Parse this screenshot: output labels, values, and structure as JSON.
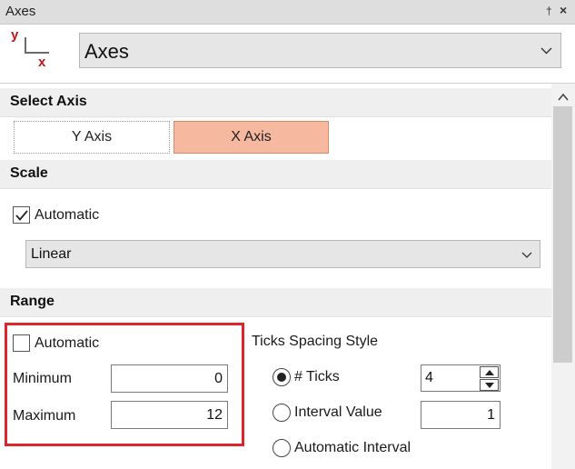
{
  "window": {
    "title": "Axes",
    "pin_glyph": "†",
    "close_glyph": "×"
  },
  "top": {
    "logo": {
      "y_letter": "y",
      "x_letter": "x",
      "icon": "axes-logo-icon"
    },
    "selector_value": "Axes"
  },
  "select_axis": {
    "header": "Select Axis",
    "tabs": [
      {
        "label": "Y Axis",
        "selected": false
      },
      {
        "label": "X Axis",
        "selected": true
      }
    ]
  },
  "scale": {
    "header": "Scale",
    "automatic_label": "Automatic",
    "automatic_checked": true,
    "type_value": "Linear"
  },
  "range": {
    "header": "Range",
    "automatic_label": "Automatic",
    "automatic_checked": false,
    "minimum_label": "Minimum",
    "minimum_value": "0",
    "maximum_label": "Maximum",
    "maximum_value": "12",
    "highlight_color": "#e0242b"
  },
  "ticks": {
    "title": "Ticks Spacing Style",
    "options": [
      {
        "label": "# Ticks",
        "selected": true
      },
      {
        "label": "Interval Value",
        "selected": false
      },
      {
        "label": "Automatic Interval",
        "selected": false
      }
    ],
    "ticks_value": "4",
    "interval_value": "1"
  },
  "colors": {
    "selected_tab": "#f6b89e",
    "logo_y": "#c0151b",
    "logo_x": "#c0151b"
  }
}
